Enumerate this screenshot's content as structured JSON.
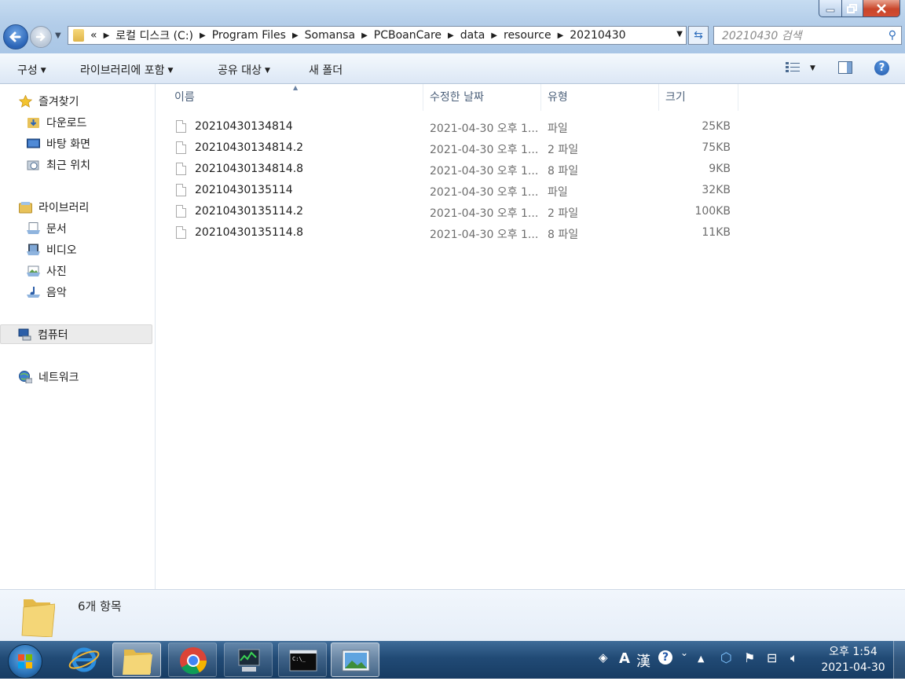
{
  "window": {
    "controls": [
      "minimize-icon",
      "maximize-icon",
      "close-icon"
    ]
  },
  "address": {
    "overflow": "«",
    "crumbs": [
      "로컬 디스크 (C:)",
      "Program Files",
      "Somansa",
      "PCBoanCare",
      "data",
      "resource",
      "20210430"
    ]
  },
  "search": {
    "placeholder": "20210430 검색"
  },
  "toolbar": {
    "organize": "구성",
    "include_library": "라이브러리에 포함",
    "share_with": "공유 대상",
    "new_folder": "새 폴더"
  },
  "nav": {
    "favorites": "즐겨찾기",
    "downloads": "다운로드",
    "desktop": "바탕 화면",
    "recent": "최근 위치",
    "libraries": "라이브러리",
    "documents": "문서",
    "videos": "비디오",
    "pictures": "사진",
    "music": "음악",
    "computer": "컴퓨터",
    "network": "네트워크"
  },
  "columns": {
    "name": "이름",
    "date": "수정한 날짜",
    "type": "유형",
    "size": "크기"
  },
  "files": [
    {
      "name": "20210430134814",
      "date": "2021-04-30 오후 1...",
      "type": "파일",
      "size": "25KB"
    },
    {
      "name": "20210430134814.2",
      "date": "2021-04-30 오후 1...",
      "type": "2 파일",
      "size": "75KB"
    },
    {
      "name": "20210430134814.8",
      "date": "2021-04-30 오후 1...",
      "type": "8 파일",
      "size": "9KB"
    },
    {
      "name": "20210430135114",
      "date": "2021-04-30 오후 1...",
      "type": "파일",
      "size": "32KB"
    },
    {
      "name": "20210430135114.2",
      "date": "2021-04-30 오후 1...",
      "type": "2 파일",
      "size": "100KB"
    },
    {
      "name": "20210430135114.8",
      "date": "2021-04-30 오후 1...",
      "type": "8 파일",
      "size": "11KB"
    }
  ],
  "details": {
    "count": "6개 항목"
  },
  "taskbar": {
    "apps": [
      "internet-explorer-icon",
      "file-explorer-icon",
      "chrome-icon",
      "task-manager-icon",
      "command-prompt-icon",
      "image-viewer-icon"
    ],
    "ime_a": "A",
    "ime_han": "漢",
    "clock_time": "오후 1:54",
    "clock_date": "2021-04-30"
  },
  "colors": {
    "accent": "#2c6cbc",
    "titlebar": "#b3cde9",
    "taskbar": "#214a75",
    "close": "#c9452a"
  }
}
